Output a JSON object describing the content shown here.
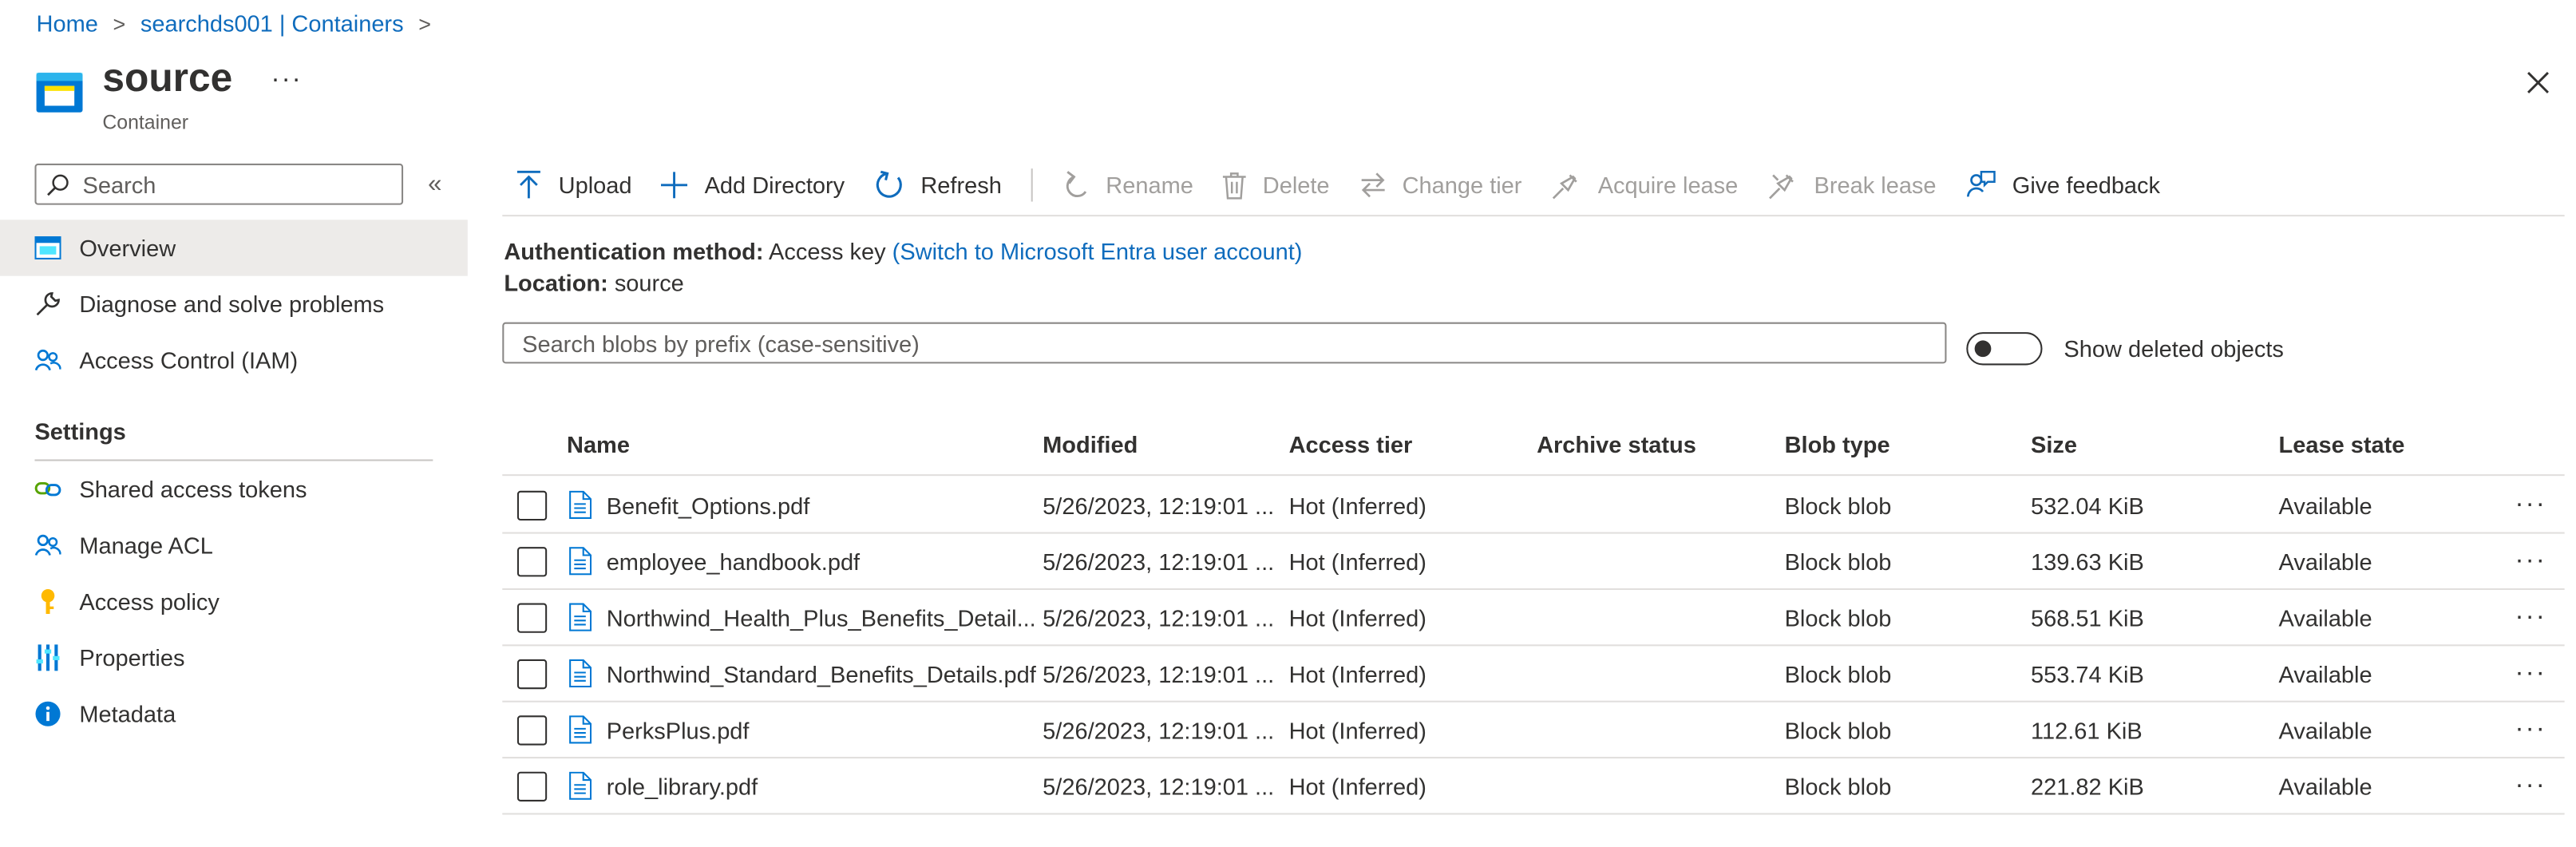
{
  "breadcrumb": {
    "items": [
      {
        "label": "Home"
      },
      {
        "label": "searchds001 | Containers"
      }
    ],
    "separator": ">"
  },
  "header": {
    "title": "source",
    "subtitle": "Container",
    "more_label": "···",
    "icon": "container-icon",
    "close_icon": "close-icon"
  },
  "sidebar": {
    "search_placeholder": "Search",
    "collapse_label": "«",
    "items": [
      {
        "label": "Overview",
        "icon": "overview-icon"
      },
      {
        "label": "Diagnose and solve problems",
        "icon": "wrench-icon"
      },
      {
        "label": "Access Control (IAM)",
        "icon": "people-icon"
      }
    ],
    "settings_heading": "Settings",
    "settings_items": [
      {
        "label": "Shared access tokens",
        "icon": "link-icon"
      },
      {
        "label": "Manage ACL",
        "icon": "people-icon"
      },
      {
        "label": "Access policy",
        "icon": "key-icon"
      },
      {
        "label": "Properties",
        "icon": "properties-icon"
      },
      {
        "label": "Metadata",
        "icon": "info-icon"
      }
    ]
  },
  "toolbar": {
    "upload": "Upload",
    "add_directory": "Add Directory",
    "refresh": "Refresh",
    "rename": "Rename",
    "delete": "Delete",
    "change_tier": "Change tier",
    "acquire_lease": "Acquire lease",
    "break_lease": "Break lease",
    "give_feedback": "Give feedback"
  },
  "info": {
    "auth_label": "Authentication method:",
    "auth_value": "Access key",
    "auth_link": "(Switch to Microsoft Entra user account)",
    "location_label": "Location:",
    "location_value": "source"
  },
  "filter": {
    "placeholder": "Search blobs by prefix (case-sensitive)",
    "show_deleted_label": "Show deleted objects",
    "show_deleted_on": false
  },
  "table": {
    "columns": [
      "Name",
      "Modified",
      "Access tier",
      "Archive status",
      "Blob type",
      "Size",
      "Lease state"
    ],
    "rows": [
      {
        "name": "Benefit_Options.pdf",
        "modified": "5/26/2023, 12:19:01 ...",
        "tier": "Hot (Inferred)",
        "archive": "",
        "type": "Block blob",
        "size": "532.04 KiB",
        "lease": "Available"
      },
      {
        "name": "employee_handbook.pdf",
        "modified": "5/26/2023, 12:19:01 ...",
        "tier": "Hot (Inferred)",
        "archive": "",
        "type": "Block blob",
        "size": "139.63 KiB",
        "lease": "Available"
      },
      {
        "name": "Northwind_Health_Plus_Benefits_Detail...",
        "modified": "5/26/2023, 12:19:01 ...",
        "tier": "Hot (Inferred)",
        "archive": "",
        "type": "Block blob",
        "size": "568.51 KiB",
        "lease": "Available"
      },
      {
        "name": "Northwind_Standard_Benefits_Details.pdf",
        "modified": "5/26/2023, 12:19:01 ...",
        "tier": "Hot (Inferred)",
        "archive": "",
        "type": "Block blob",
        "size": "553.74 KiB",
        "lease": "Available"
      },
      {
        "name": "PerksPlus.pdf",
        "modified": "5/26/2023, 12:19:01 ...",
        "tier": "Hot (Inferred)",
        "archive": "",
        "type": "Block blob",
        "size": "112.61 KiB",
        "lease": "Available"
      },
      {
        "name": "role_library.pdf",
        "modified": "5/26/2023, 12:19:01 ...",
        "tier": "Hot (Inferred)",
        "archive": "",
        "type": "Block blob",
        "size": "221.82 KiB",
        "lease": "Available"
      }
    ],
    "row_more_label": "···"
  },
  "colors": {
    "link": "#0f6cbd",
    "text": "#323130",
    "disabled": "#a19f9d",
    "nav_active": "#edebe9",
    "icon_blue": "#0078d4"
  }
}
